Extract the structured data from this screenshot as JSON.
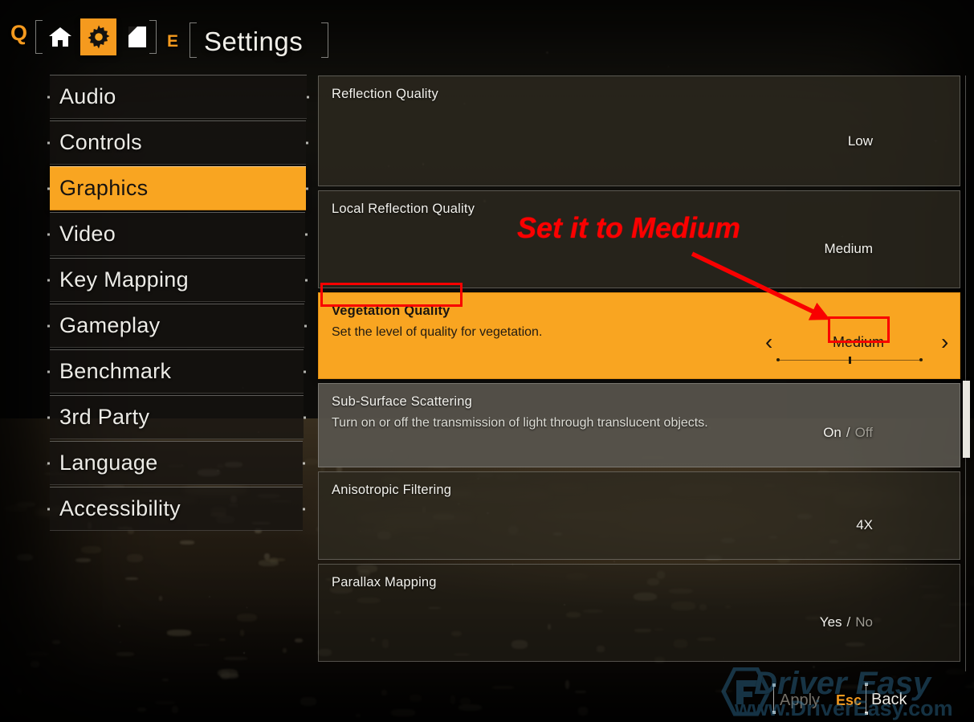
{
  "window": {
    "title": "Settings"
  },
  "topnav": {
    "left_key": "Q",
    "right_key": "E",
    "items": [
      {
        "icon": "home-icon",
        "label": "Home",
        "active": false
      },
      {
        "icon": "gear-icon",
        "label": "Settings",
        "active": true
      },
      {
        "icon": "document-icon",
        "label": "Log",
        "active": false
      }
    ]
  },
  "sidebar": {
    "items": [
      {
        "label": "Audio",
        "selected": false
      },
      {
        "label": "Controls",
        "selected": false
      },
      {
        "label": "Graphics",
        "selected": true
      },
      {
        "label": "Video",
        "selected": false
      },
      {
        "label": "Key Mapping",
        "selected": false
      },
      {
        "label": "Gameplay",
        "selected": false
      },
      {
        "label": "Benchmark",
        "selected": false
      },
      {
        "label": "3rd Party",
        "selected": false
      },
      {
        "label": "Language",
        "selected": false
      },
      {
        "label": "Accessibility",
        "selected": false
      }
    ]
  },
  "settings": {
    "rows": [
      {
        "title": "Reflection Quality",
        "description": "",
        "value": "Low",
        "value_off": "",
        "state": "normal",
        "control": "value"
      },
      {
        "title": "Local Reflection Quality",
        "description": "",
        "value": "Medium",
        "value_off": "",
        "state": "normal",
        "control": "value"
      },
      {
        "title": "Vegetation Quality",
        "description": "Set the level of quality for vegetation.",
        "value": "Medium",
        "value_off": "",
        "state": "selected",
        "control": "stepper",
        "prev_arrow": "‹",
        "next_arrow": "›",
        "slider_steps": 3,
        "slider_index": 1
      },
      {
        "title": "Sub-Surface Scattering",
        "description": "Turn on or off the transmission of light through translucent objects.",
        "value": "On",
        "value_off": "Off",
        "separator": "/",
        "state": "hover",
        "control": "toggle"
      },
      {
        "title": "Anisotropic Filtering",
        "description": "",
        "value": "4X",
        "value_off": "",
        "state": "normal",
        "control": "value"
      },
      {
        "title": "Parallax Mapping",
        "description": "",
        "value": "Yes",
        "value_off": "No",
        "separator": "/",
        "state": "dim",
        "control": "toggle"
      }
    ]
  },
  "annotations": [
    {
      "type": "text",
      "text": "Set it to Medium",
      "color": "#fb0000"
    },
    {
      "type": "box",
      "target": "Vegetation Quality",
      "color": "#f90000"
    },
    {
      "type": "box",
      "target": "Medium value",
      "color": "#f90000"
    },
    {
      "type": "arrow",
      "color": "#f90000"
    }
  ],
  "bottombar": {
    "apply_label": "Apply",
    "esc_key": "Esc",
    "back_label": "Back"
  },
  "watermark": {
    "brand": "Driver Easy",
    "url": "www.DriverEasy.com"
  },
  "colors": {
    "accent_orange": "#f9a521",
    "annotation_red": "#f90000",
    "panel_dark": "#2d291f",
    "panel_hover": "#58554d",
    "text_light": "#f2f1ec",
    "watermark_blue": "#2e6f96"
  }
}
